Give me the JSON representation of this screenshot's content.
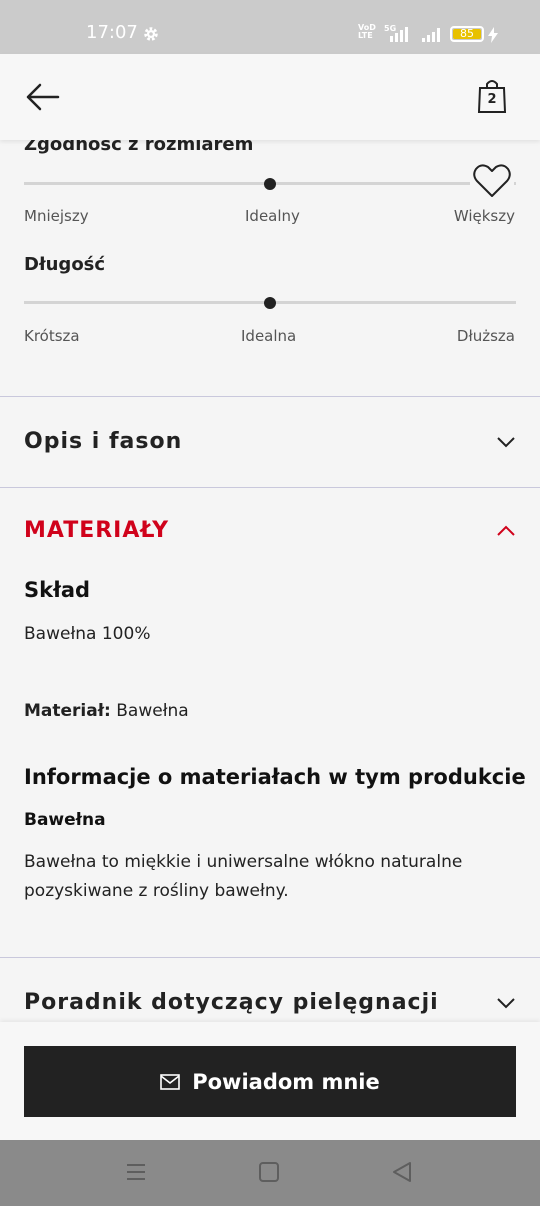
{
  "status_bar": {
    "time": "17:07",
    "network_label_top": "VoD",
    "network_label_bottom": "LTE",
    "network_type": "5G",
    "battery": "85"
  },
  "header": {
    "cart_count": "2"
  },
  "fit": {
    "size_fit": {
      "label": "Zgodność z rozmiarem",
      "left": "Mniejszy",
      "middle": "Idealny",
      "right": "Większy",
      "value": 0.5
    },
    "length": {
      "label": "Długość",
      "left": "Krótsza",
      "middle": "Idealna",
      "right": "Dłuższa",
      "value": 0.5
    }
  },
  "sections": {
    "description": "Opis i fason",
    "materials": "MATERIAŁY",
    "care": "Poradnik dotyczący pielęgnacji"
  },
  "materials": {
    "composition_heading": "Skład",
    "composition_value": "Bawełna 100%",
    "material_label": "Materiał:",
    "material_value": " Bawełna",
    "info_heading": "Informacje o materiałach w tym produkcie",
    "info_subheading": "Bawełna",
    "info_line1": "Bawełna to miękkie i uniwersalne włókno naturalne",
    "info_line2": "pozyskiwane z rośliny bawełny."
  },
  "bottom": {
    "notify_label": "Powiadom mnie"
  },
  "colors": {
    "accent_red": "#d0021b",
    "button_dark": "#222222",
    "divider": "#c9c8dc"
  },
  "icons": [
    "settings-gear-icon",
    "signal-icon",
    "battery-icon",
    "charging-bolt-icon",
    "back-arrow-icon",
    "shopping-bag-icon",
    "heart-icon",
    "chevron-down-icon",
    "chevron-up-icon",
    "mail-icon",
    "recents-icon",
    "home-icon",
    "back-triangle-icon"
  ]
}
